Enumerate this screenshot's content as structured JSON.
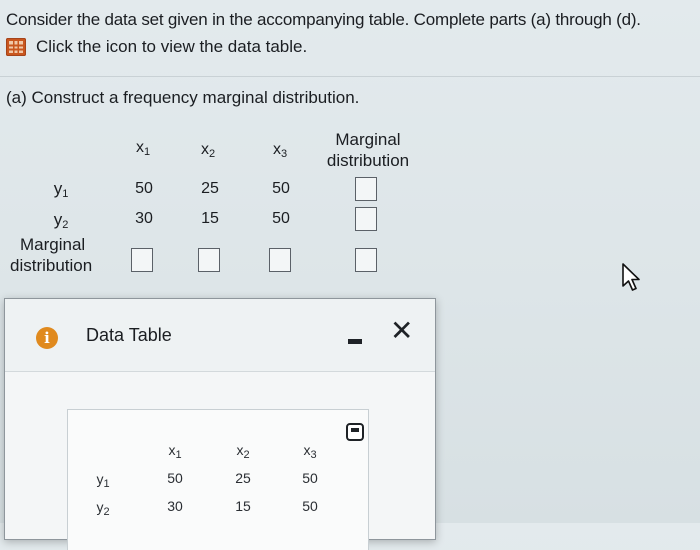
{
  "question": {
    "intro": "Consider the data set given in the accompanying table. Complete parts (a) through (d).",
    "data_table_link": "Click the icon to view the data table.",
    "part_a": "(a) Construct a frequency marginal distribution."
  },
  "main_table": {
    "col_headers": [
      {
        "base": "x",
        "sub": "1"
      },
      {
        "base": "x",
        "sub": "2"
      },
      {
        "base": "x",
        "sub": "3"
      }
    ],
    "marginal_header_line1": "Marginal",
    "marginal_header_line2": "distribution",
    "rows": [
      {
        "base": "y",
        "sub": "1",
        "values": [
          "50",
          "25",
          "50"
        ]
      },
      {
        "base": "y",
        "sub": "2",
        "values": [
          "30",
          "15",
          "50"
        ]
      }
    ],
    "marginal_row_label_line1": "Marginal",
    "marginal_row_label_line2": "distribution"
  },
  "dialog": {
    "title": "Data Table",
    "table": {
      "col_headers": [
        {
          "base": "x",
          "sub": "1"
        },
        {
          "base": "x",
          "sub": "2"
        },
        {
          "base": "x",
          "sub": "3"
        }
      ],
      "rows": [
        {
          "base": "y",
          "sub": "1",
          "values": [
            "50",
            "25",
            "50"
          ]
        },
        {
          "base": "y",
          "sub": "2",
          "values": [
            "30",
            "15",
            "50"
          ]
        }
      ]
    }
  },
  "icons": {
    "data_table_icon": "grid-icon",
    "info_icon": "info-icon",
    "minimize_icon": "minimize-icon",
    "close_icon": "close-icon",
    "copy_icon": "copy-icon",
    "cursor": "mouse-cursor-icon"
  },
  "colors": {
    "accent_orange": "#c9561e",
    "info_orange": "#e08a1e"
  }
}
